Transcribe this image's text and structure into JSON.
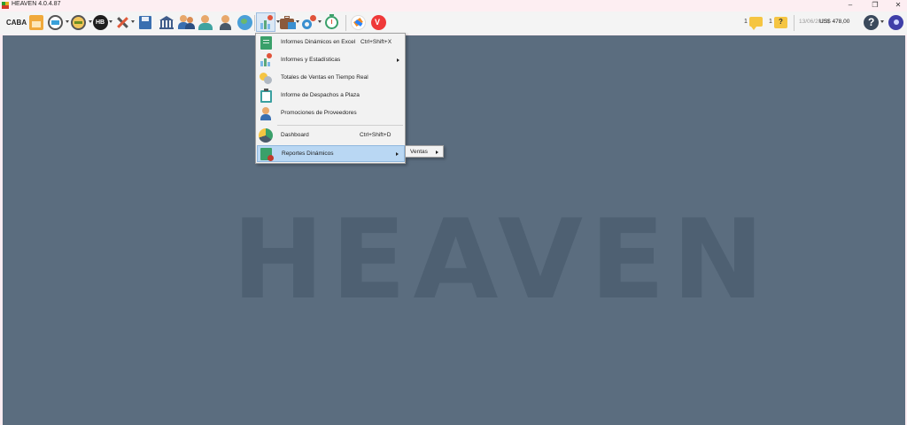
{
  "window": {
    "title": "HEAVEN 4.0.4.87",
    "minimize": "–",
    "maximize": "❐",
    "close": "✕"
  },
  "toolbar": {
    "store": "CABA",
    "messages_count": "1",
    "alerts_count": "1",
    "date": "13/06/2023",
    "balance": "US$ 478,00",
    "icons": [
      "tags-icon",
      "printer-icon",
      "cash-icon",
      "hb-icon",
      "tools-icon",
      "save-disk-icon",
      "bank-icon",
      "users-icon",
      "person-card-icon",
      "assistant-icon",
      "globe-icon",
      "reports-chart-icon",
      "briefcase-icon",
      "settings-gears-icon",
      "stopwatch-icon",
      "jira-icon",
      "vivaldi-icon",
      "chat-icon",
      "question-note-icon",
      "help-icon",
      "user-avatar-icon"
    ]
  },
  "menu": {
    "items": [
      {
        "label": "Informes Dinámicos en Excel",
        "shortcut": "Ctrl+Shift+X",
        "icon": "excel-report-icon"
      },
      {
        "label": "Informes y Estadísticas",
        "icon": "statistics-chart-icon"
      },
      {
        "label": "Totales de Ventas en Tiempo Real",
        "icon": "coins-icon"
      },
      {
        "label": "Informe de Despachos a Plaza",
        "icon": "clipboard-icon"
      },
      {
        "label": "Promociones de Proveedores",
        "icon": "provider-icon"
      },
      {
        "label": "Dashboard",
        "shortcut": "Ctrl+Shift+D",
        "icon": "pie-chart-icon"
      },
      {
        "label": "Reportes Dinámicos",
        "icon": "dynamic-report-icon"
      }
    ],
    "submenu": {
      "label": "Ventas"
    }
  },
  "watermark": "HEAVEN",
  "colors": {
    "workspace": "#5b6d7f",
    "highlight": "#b9d7f3",
    "titlebar": "#fdeef2"
  }
}
